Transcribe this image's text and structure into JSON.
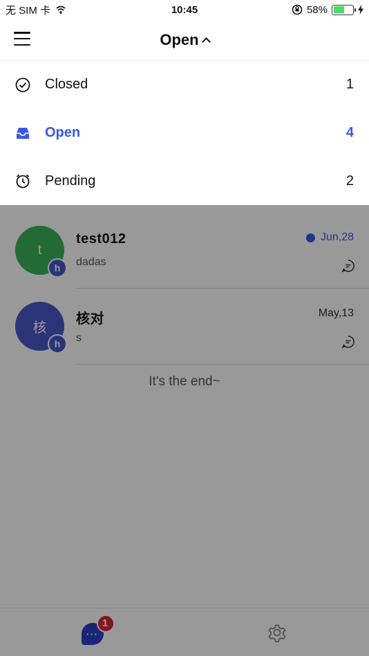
{
  "status_bar": {
    "carrier": "无 SIM 卡",
    "time": "10:45",
    "battery": "58%",
    "battery_level": 0.58
  },
  "header": {
    "title": "Open"
  },
  "dropdown": {
    "items": [
      {
        "label": "Closed",
        "count": "1",
        "icon": "check-circle-icon"
      },
      {
        "label": "Open",
        "count": "4",
        "icon": "inbox-icon"
      },
      {
        "label": "Pending",
        "count": "2",
        "icon": "alarm-clock-icon"
      }
    ]
  },
  "conversations": [
    {
      "initial": "t",
      "name": "test012",
      "message": "dadas",
      "date": "Jun,28",
      "unread": true,
      "agent_badge": "h",
      "avatar_color": "#3bb35b"
    },
    {
      "initial": "核",
      "name": "核对",
      "message": "s",
      "date": "May,13",
      "unread": false,
      "agent_badge": "h",
      "avatar_color": "#4a58c8"
    }
  ],
  "end_text": "It's the end~",
  "bottom_nav": {
    "chat_badge": "1",
    "chat_glyph": "···"
  },
  "colors": {
    "accent": "#3a57e8",
    "unread": "#3a57e8",
    "badge": "#d8262f"
  }
}
